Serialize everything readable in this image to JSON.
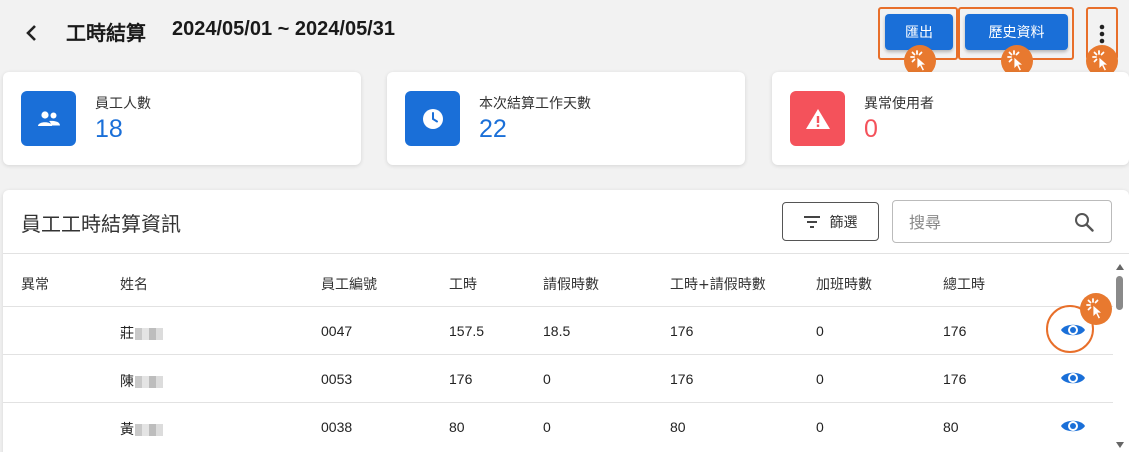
{
  "header": {
    "title": "工時結算",
    "date_range": "2024/05/01 ~ 2024/05/31",
    "export_label": "匯出",
    "history_label": "歷史資料"
  },
  "stats": [
    {
      "label": "員工人數",
      "value": "18",
      "icon": "people-icon",
      "color": "#1a6fd8"
    },
    {
      "label": "本次結算工作天數",
      "value": "22",
      "icon": "clock-icon",
      "color": "#1a6fd8"
    },
    {
      "label": "異常使用者",
      "value": "0",
      "icon": "warning-icon",
      "color": "#f4525b"
    }
  ],
  "panel": {
    "title": "員工工時結算資訊",
    "filter_label": "篩選",
    "search_placeholder": "搜尋"
  },
  "table": {
    "columns": [
      "異常",
      "姓名",
      "員工編號",
      "工時",
      "請假時數",
      "工時+請假時數",
      "加班時數",
      "總工時"
    ],
    "rows": [
      {
        "anomaly": "",
        "name": "莊",
        "employee_id": "0047",
        "hours": "157.5",
        "leave_hours": "18.5",
        "hours_plus_leave": "176",
        "overtime": "0",
        "total": "176"
      },
      {
        "anomaly": "",
        "name": "陳",
        "employee_id": "0053",
        "hours": "176",
        "leave_hours": "0",
        "hours_plus_leave": "176",
        "overtime": "0",
        "total": "176"
      },
      {
        "anomaly": "",
        "name": "黃",
        "employee_id": "0038",
        "hours": "80",
        "leave_hours": "0",
        "hours_plus_leave": "80",
        "overtime": "0",
        "total": "80"
      }
    ]
  },
  "colors": {
    "primary": "#1a6fd8",
    "danger": "#f4525b",
    "highlight": "#e86f2a"
  }
}
